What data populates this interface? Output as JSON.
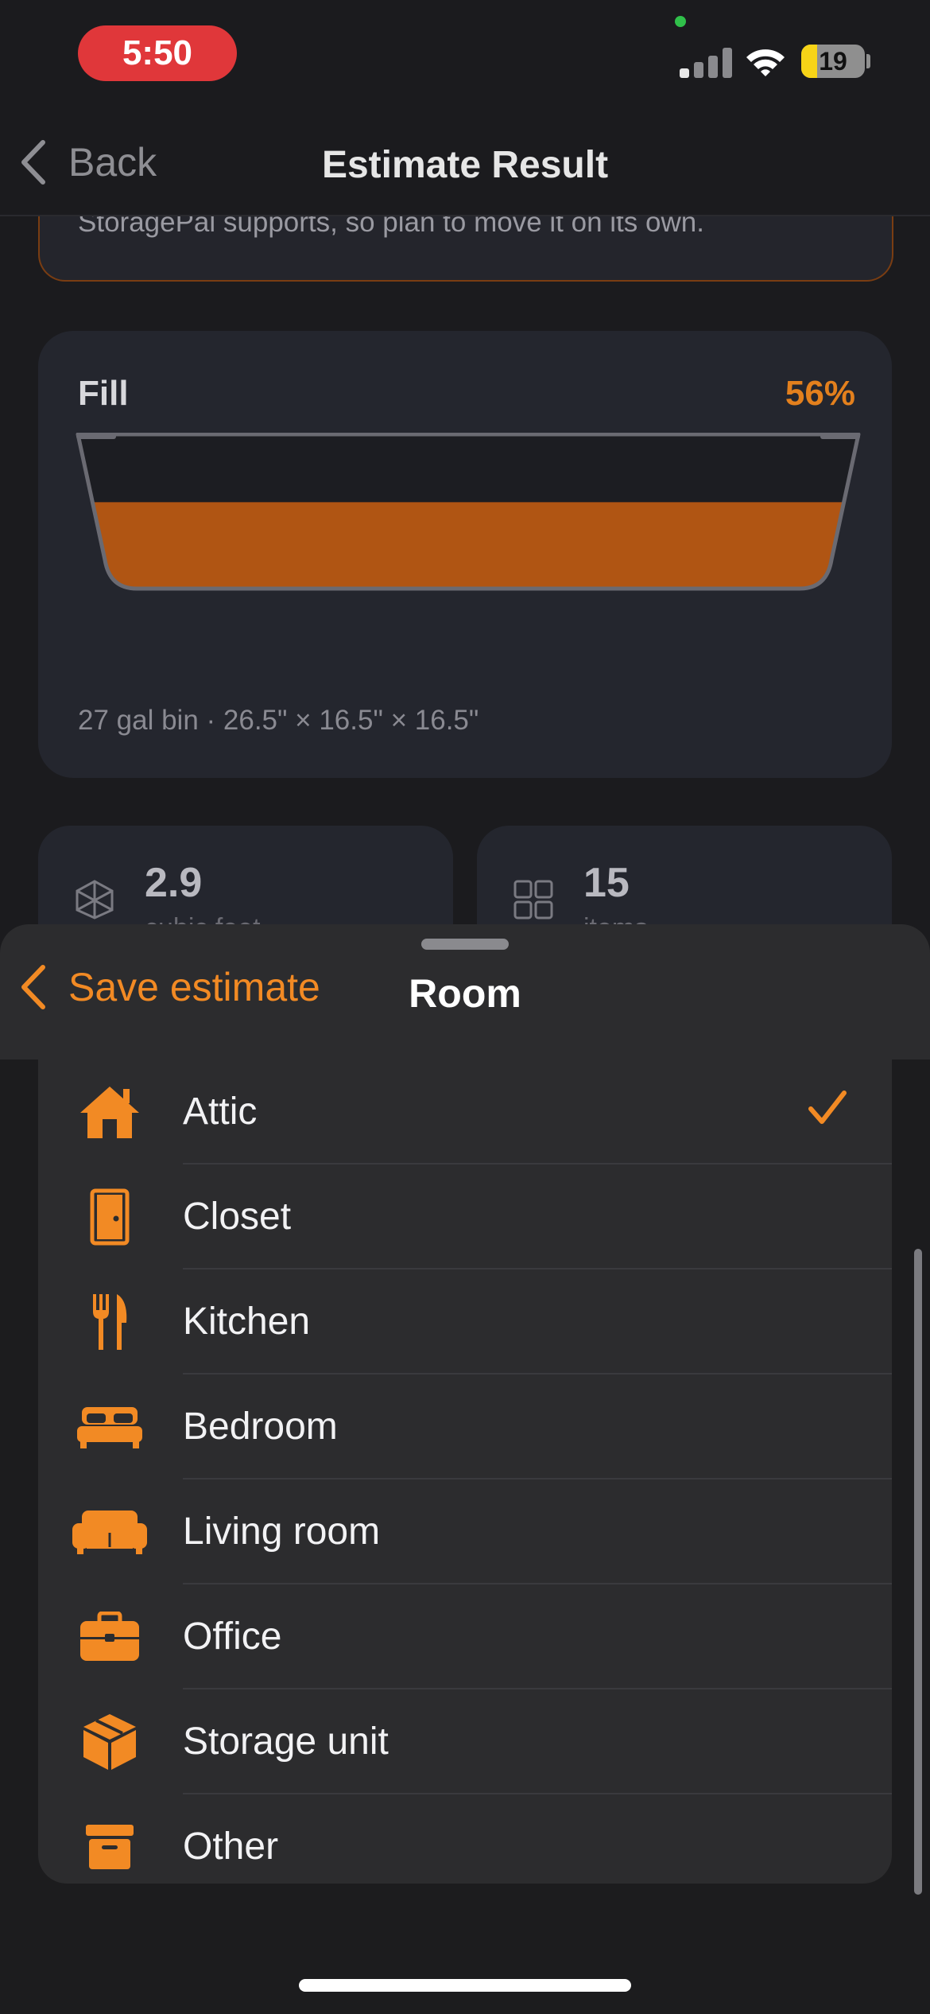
{
  "status_bar": {
    "time": "5:50",
    "battery": "19"
  },
  "nav": {
    "back_label": "Back",
    "title": "Estimate Result"
  },
  "warning": {
    "text": "StoragePal supports, so plan to move it on its own."
  },
  "fill": {
    "label": "Fill",
    "percent_text": "56%",
    "fill_fraction": 0.56,
    "caption": "27 gal bin · 26.5\" × 16.5\" × 16.5\"",
    "fill_color": "#b05513"
  },
  "stats": [
    {
      "value": "2.9",
      "label": "cubic feet",
      "icon": "cube-icon"
    },
    {
      "value": "15",
      "label": "items",
      "icon": "grid-icon"
    }
  ],
  "sheet": {
    "back_label": "Save estimate",
    "title": "Room",
    "accent": "#f28a24",
    "items": [
      {
        "label": "Attic",
        "icon": "house-icon",
        "selected": true
      },
      {
        "label": "Closet",
        "icon": "door-icon",
        "selected": false
      },
      {
        "label": "Kitchen",
        "icon": "fork-knife-icon",
        "selected": false
      },
      {
        "label": "Bedroom",
        "icon": "bed-icon",
        "selected": false
      },
      {
        "label": "Living room",
        "icon": "sofa-icon",
        "selected": false
      },
      {
        "label": "Office",
        "icon": "briefcase-icon",
        "selected": false
      },
      {
        "label": "Storage unit",
        "icon": "box-icon",
        "selected": false
      },
      {
        "label": "Other",
        "icon": "archive-box-icon",
        "selected": false
      }
    ]
  }
}
